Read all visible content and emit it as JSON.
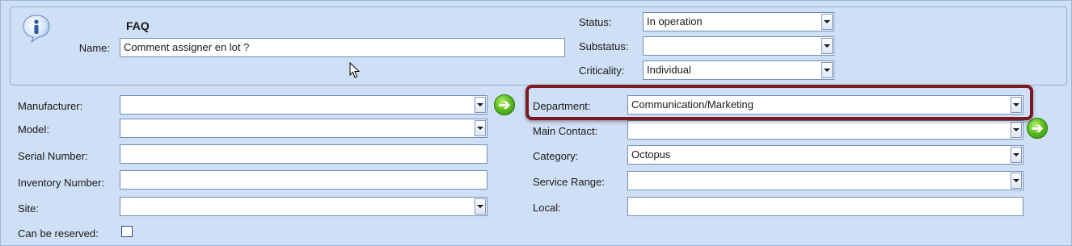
{
  "header": {
    "title": "FAQ",
    "name_label": "Name:",
    "name_value": "Comment assigner en lot ?",
    "status_label": "Status:",
    "status_value": "In operation",
    "substatus_label": "Substatus:",
    "substatus_value": "",
    "criticality_label": "Criticality:",
    "criticality_value": "Individual",
    "info_icon": "info-icon"
  },
  "left_fields": {
    "manufacturer_label": "Manufacturer:",
    "manufacturer_value": "",
    "model_label": "Model:",
    "model_value": "",
    "serial_label": "Serial Number:",
    "serial_value": "",
    "inventory_label": "Inventory Number:",
    "inventory_value": "",
    "site_label": "Site:",
    "site_value": "",
    "reservable_label": "Can be reserved:",
    "reservable_checked": false
  },
  "right_fields": {
    "department_label": "Department:",
    "department_value": "Communication/Marketing",
    "main_contact_label": "Main Contact:",
    "main_contact_value": "",
    "category_label": "Category:",
    "category_value": "Octopus",
    "service_range_label": "Service Range:",
    "service_range_value": "",
    "local_label": "Local:",
    "local_value": ""
  },
  "icons": {
    "go_arrow": "arrow-right-icon",
    "dropdown": "chevron-down-icon",
    "cursor": "mouse-cursor"
  },
  "colors": {
    "background": "#cfdff5",
    "highlight_border": "#7a1a22",
    "go_button": "#5fbf1f"
  }
}
